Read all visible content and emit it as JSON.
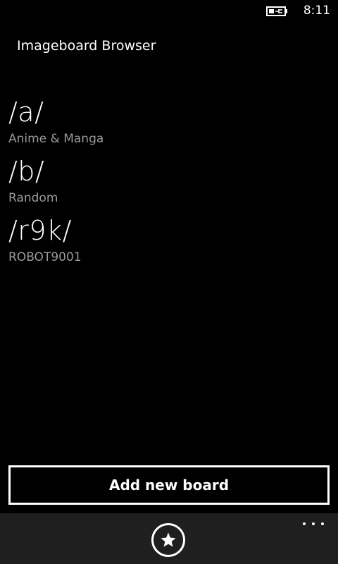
{
  "status_bar": {
    "battery_icon": "battery-charging-icon",
    "time": "8:11"
  },
  "app": {
    "title": "Imageboard Browser"
  },
  "boards": [
    {
      "name": "/a/",
      "description": "Anime & Manga"
    },
    {
      "name": "/b/",
      "description": "Random"
    },
    {
      "name": "/r9k/",
      "description": "ROBOT9001"
    }
  ],
  "actions": {
    "add_board_label": "Add new board"
  },
  "app_bar": {
    "favorites_icon": "star-icon",
    "more_icon": "ellipsis-icon"
  },
  "colors": {
    "background": "#000000",
    "text": "#ffffff",
    "secondary_text": "#9a9a9a",
    "app_bar": "#1f1f1f"
  }
}
